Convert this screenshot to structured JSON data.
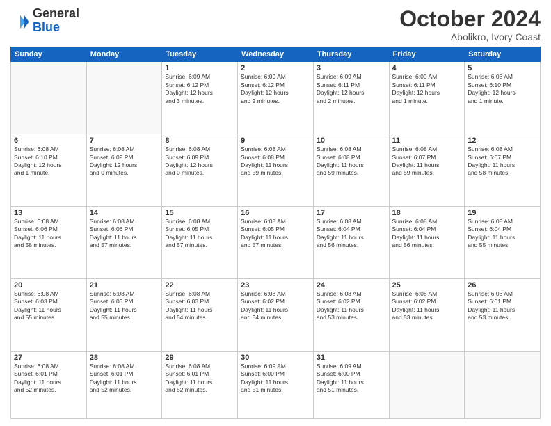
{
  "logo": {
    "general": "General",
    "blue": "Blue"
  },
  "header": {
    "month_year": "October 2024",
    "location": "Abolikro, Ivory Coast"
  },
  "weekdays": [
    "Sunday",
    "Monday",
    "Tuesday",
    "Wednesday",
    "Thursday",
    "Friday",
    "Saturday"
  ],
  "weeks": [
    [
      {
        "day": "",
        "detail": ""
      },
      {
        "day": "",
        "detail": ""
      },
      {
        "day": "1",
        "detail": "Sunrise: 6:09 AM\nSunset: 6:12 PM\nDaylight: 12 hours\nand 3 minutes."
      },
      {
        "day": "2",
        "detail": "Sunrise: 6:09 AM\nSunset: 6:12 PM\nDaylight: 12 hours\nand 2 minutes."
      },
      {
        "day": "3",
        "detail": "Sunrise: 6:09 AM\nSunset: 6:11 PM\nDaylight: 12 hours\nand 2 minutes."
      },
      {
        "day": "4",
        "detail": "Sunrise: 6:09 AM\nSunset: 6:11 PM\nDaylight: 12 hours\nand 1 minute."
      },
      {
        "day": "5",
        "detail": "Sunrise: 6:08 AM\nSunset: 6:10 PM\nDaylight: 12 hours\nand 1 minute."
      }
    ],
    [
      {
        "day": "6",
        "detail": "Sunrise: 6:08 AM\nSunset: 6:10 PM\nDaylight: 12 hours\nand 1 minute."
      },
      {
        "day": "7",
        "detail": "Sunrise: 6:08 AM\nSunset: 6:09 PM\nDaylight: 12 hours\nand 0 minutes."
      },
      {
        "day": "8",
        "detail": "Sunrise: 6:08 AM\nSunset: 6:09 PM\nDaylight: 12 hours\nand 0 minutes."
      },
      {
        "day": "9",
        "detail": "Sunrise: 6:08 AM\nSunset: 6:08 PM\nDaylight: 11 hours\nand 59 minutes."
      },
      {
        "day": "10",
        "detail": "Sunrise: 6:08 AM\nSunset: 6:08 PM\nDaylight: 11 hours\nand 59 minutes."
      },
      {
        "day": "11",
        "detail": "Sunrise: 6:08 AM\nSunset: 6:07 PM\nDaylight: 11 hours\nand 59 minutes."
      },
      {
        "day": "12",
        "detail": "Sunrise: 6:08 AM\nSunset: 6:07 PM\nDaylight: 11 hours\nand 58 minutes."
      }
    ],
    [
      {
        "day": "13",
        "detail": "Sunrise: 6:08 AM\nSunset: 6:06 PM\nDaylight: 11 hours\nand 58 minutes."
      },
      {
        "day": "14",
        "detail": "Sunrise: 6:08 AM\nSunset: 6:06 PM\nDaylight: 11 hours\nand 57 minutes."
      },
      {
        "day": "15",
        "detail": "Sunrise: 6:08 AM\nSunset: 6:05 PM\nDaylight: 11 hours\nand 57 minutes."
      },
      {
        "day": "16",
        "detail": "Sunrise: 6:08 AM\nSunset: 6:05 PM\nDaylight: 11 hours\nand 57 minutes."
      },
      {
        "day": "17",
        "detail": "Sunrise: 6:08 AM\nSunset: 6:04 PM\nDaylight: 11 hours\nand 56 minutes."
      },
      {
        "day": "18",
        "detail": "Sunrise: 6:08 AM\nSunset: 6:04 PM\nDaylight: 11 hours\nand 56 minutes."
      },
      {
        "day": "19",
        "detail": "Sunrise: 6:08 AM\nSunset: 6:04 PM\nDaylight: 11 hours\nand 55 minutes."
      }
    ],
    [
      {
        "day": "20",
        "detail": "Sunrise: 6:08 AM\nSunset: 6:03 PM\nDaylight: 11 hours\nand 55 minutes."
      },
      {
        "day": "21",
        "detail": "Sunrise: 6:08 AM\nSunset: 6:03 PM\nDaylight: 11 hours\nand 55 minutes."
      },
      {
        "day": "22",
        "detail": "Sunrise: 6:08 AM\nSunset: 6:03 PM\nDaylight: 11 hours\nand 54 minutes."
      },
      {
        "day": "23",
        "detail": "Sunrise: 6:08 AM\nSunset: 6:02 PM\nDaylight: 11 hours\nand 54 minutes."
      },
      {
        "day": "24",
        "detail": "Sunrise: 6:08 AM\nSunset: 6:02 PM\nDaylight: 11 hours\nand 53 minutes."
      },
      {
        "day": "25",
        "detail": "Sunrise: 6:08 AM\nSunset: 6:02 PM\nDaylight: 11 hours\nand 53 minutes."
      },
      {
        "day": "26",
        "detail": "Sunrise: 6:08 AM\nSunset: 6:01 PM\nDaylight: 11 hours\nand 53 minutes."
      }
    ],
    [
      {
        "day": "27",
        "detail": "Sunrise: 6:08 AM\nSunset: 6:01 PM\nDaylight: 11 hours\nand 52 minutes."
      },
      {
        "day": "28",
        "detail": "Sunrise: 6:08 AM\nSunset: 6:01 PM\nDaylight: 11 hours\nand 52 minutes."
      },
      {
        "day": "29",
        "detail": "Sunrise: 6:08 AM\nSunset: 6:01 PM\nDaylight: 11 hours\nand 52 minutes."
      },
      {
        "day": "30",
        "detail": "Sunrise: 6:09 AM\nSunset: 6:00 PM\nDaylight: 11 hours\nand 51 minutes."
      },
      {
        "day": "31",
        "detail": "Sunrise: 6:09 AM\nSunset: 6:00 PM\nDaylight: 11 hours\nand 51 minutes."
      },
      {
        "day": "",
        "detail": ""
      },
      {
        "day": "",
        "detail": ""
      }
    ]
  ]
}
